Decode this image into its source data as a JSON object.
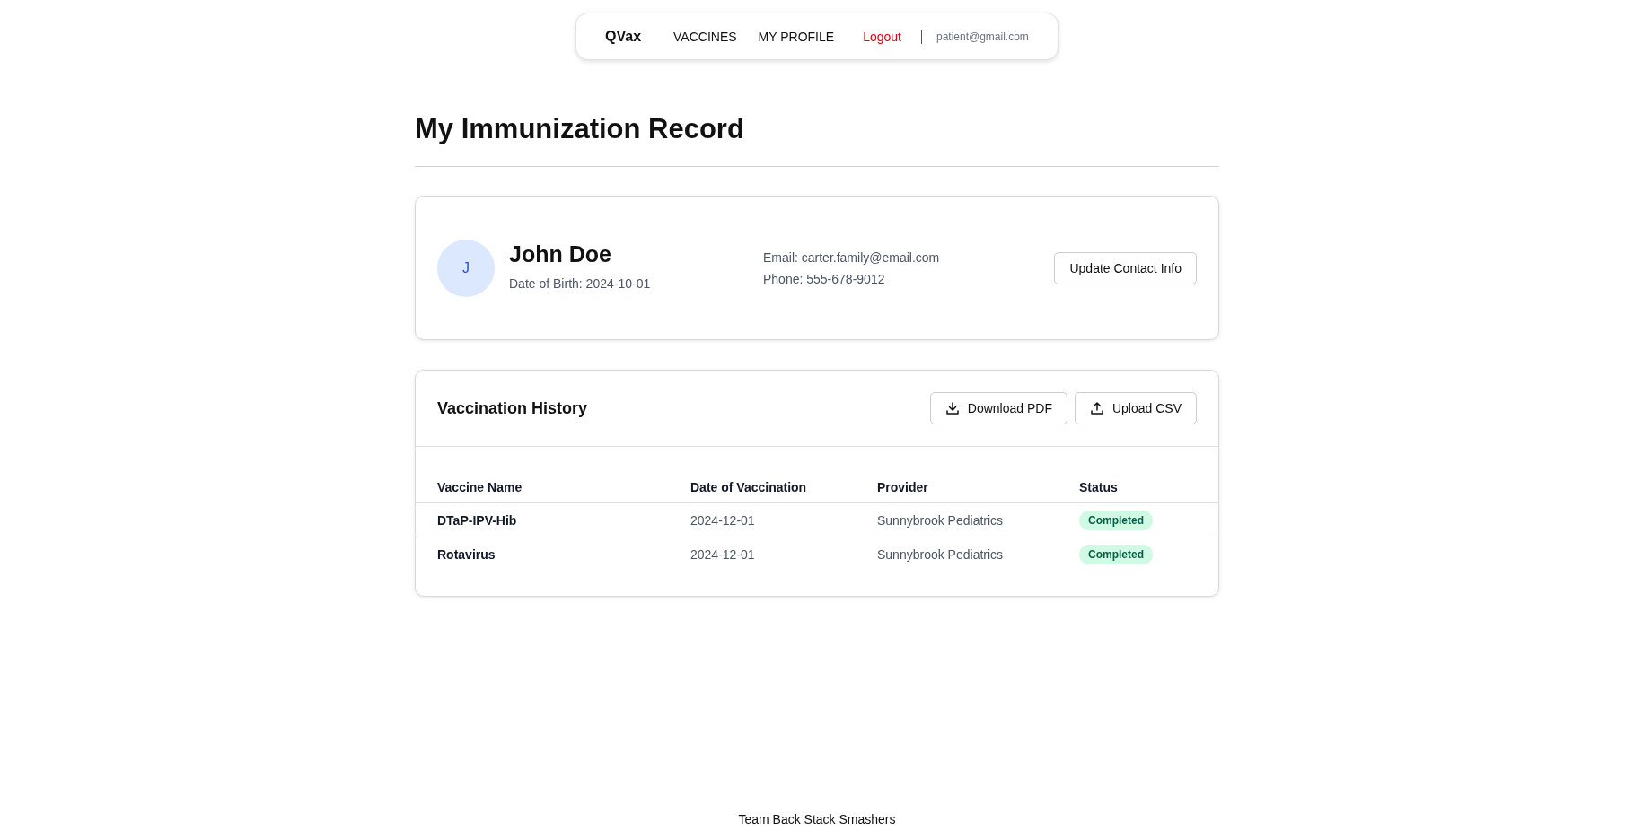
{
  "nav": {
    "brand": "QVax",
    "items": [
      {
        "label": "VACCINES",
        "kind": "link"
      },
      {
        "label": "MY PROFILE",
        "kind": "link"
      },
      {
        "label": "Logout",
        "kind": "logout"
      }
    ],
    "user": "patient@gmail.com"
  },
  "page_title": "My Immunization Record",
  "profile": {
    "initial": "J",
    "name": "John Doe",
    "dob": "Date of Birth: 2024-10-01",
    "email": "Email: carter.family@email.com",
    "phone": "Phone: 555-678-9012",
    "button": "Update Contact Info"
  },
  "history": {
    "title": "Vaccination History",
    "buttons": [
      {
        "label": "Download PDF",
        "kind": "download"
      },
      {
        "label": "Upload CSV",
        "kind": "upload"
      }
    ],
    "columns": [
      "Vaccine Name",
      "Date of Vaccination",
      "Provider",
      "Status"
    ],
    "rows": [
      {
        "vaccine": "DTaP-IPV-Hib",
        "date": "2024-12-01",
        "provider": "Sunnybrook Pediatrics",
        "status": "Completed"
      },
      {
        "vaccine": "Rotavirus",
        "date": "2024-12-01",
        "provider": "Sunnybrook Pediatrics",
        "status": "Completed"
      }
    ]
  },
  "footer": "Team Back Stack Smashers"
}
